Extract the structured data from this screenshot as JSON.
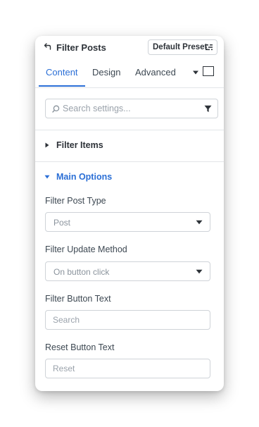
{
  "header": {
    "title": "Filter Posts",
    "preset_label": "Default Preset"
  },
  "tabs": [
    {
      "label": "Content",
      "active": true
    },
    {
      "label": "Design",
      "active": false
    },
    {
      "label": "Advanced",
      "active": false
    }
  ],
  "search": {
    "placeholder": "Search settings...",
    "value": ""
  },
  "sections": {
    "filter_items": {
      "label": "Filter Items",
      "expanded": false
    },
    "main_options": {
      "label": "Main Options",
      "expanded": true
    }
  },
  "fields": {
    "post_type": {
      "label": "Filter Post Type",
      "value": "Post"
    },
    "update_method": {
      "label": "Filter Update Method",
      "value": "On button click"
    },
    "button_text": {
      "label": "Filter Button Text",
      "placeholder": "Search",
      "value": ""
    },
    "reset_text": {
      "label": "Reset Button Text",
      "placeholder": "Reset",
      "value": ""
    }
  },
  "colors": {
    "accent": "#2b6fd6",
    "text": "#2d3238",
    "border": "#cfd3d8",
    "muted": "#8a939c"
  }
}
